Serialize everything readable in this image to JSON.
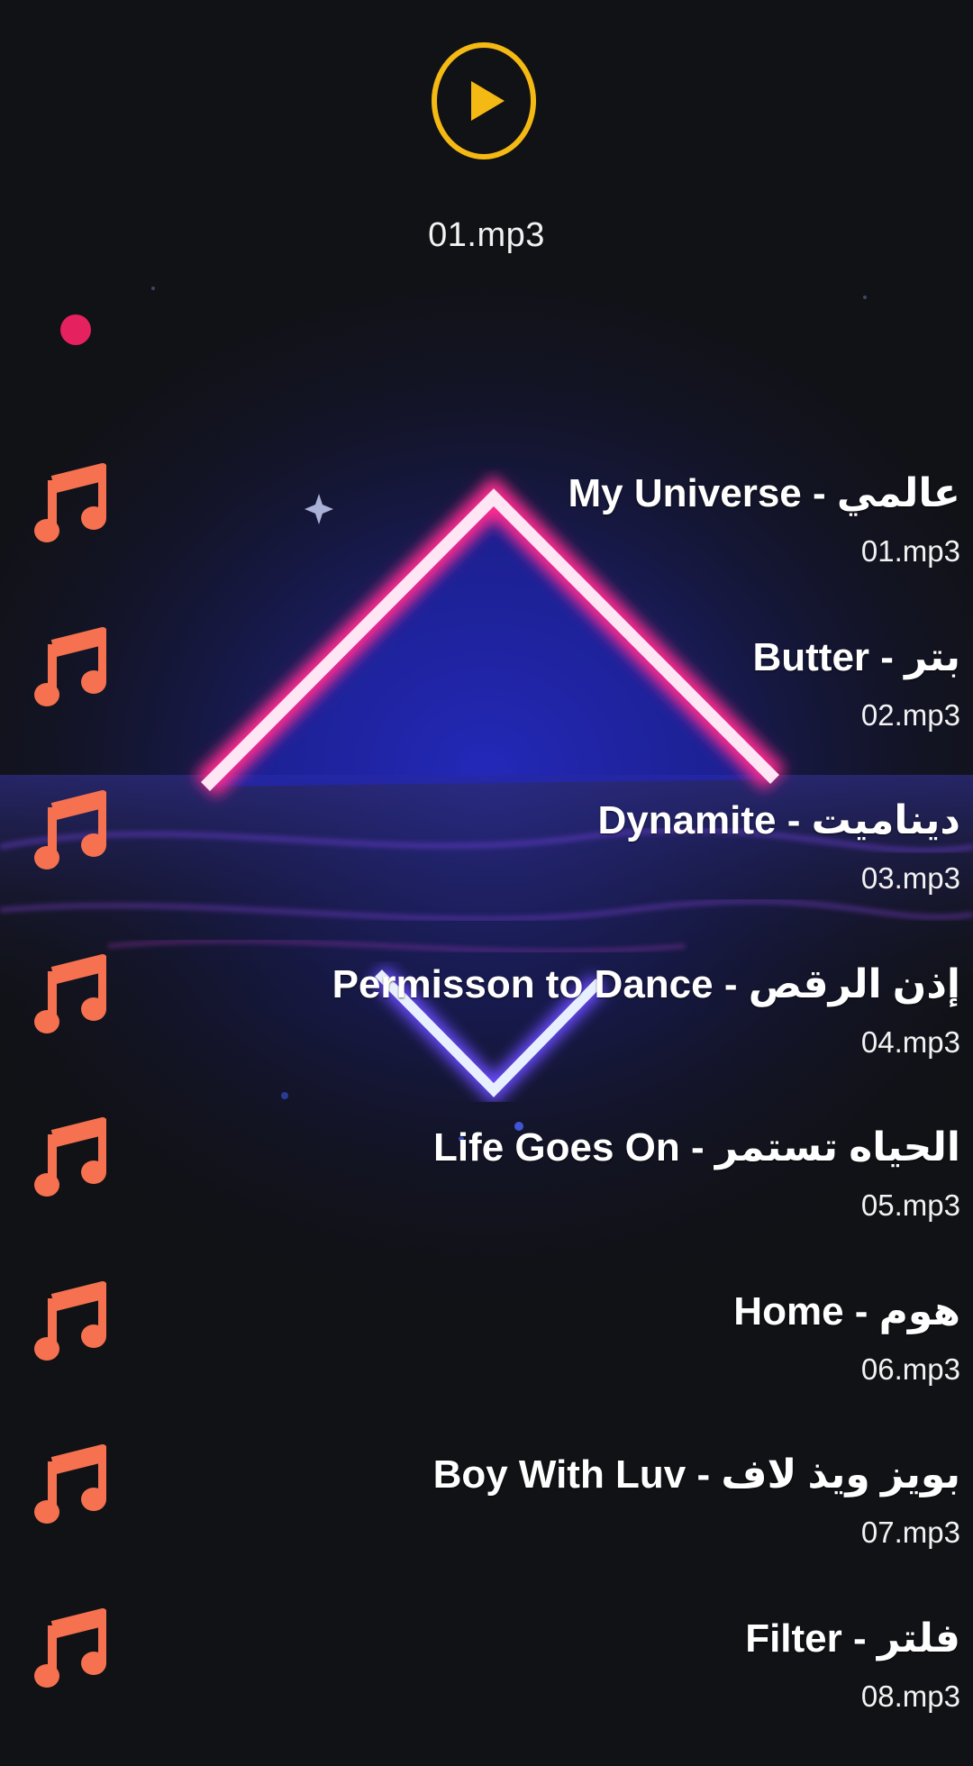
{
  "player": {
    "now_playing": "01.mp3",
    "play_icon": "play-circle-icon",
    "accent_color": "#f5b914",
    "record_dot_color": "#e5215f"
  },
  "playlist": {
    "icon": "music-note-icon",
    "icon_color": "#f5714f",
    "tracks": [
      {
        "title": "My Universe - عالمي",
        "file": "01.mp3"
      },
      {
        "title": "Butter - بتر",
        "file": "02.mp3"
      },
      {
        "title": "Dynamite - ديناميت",
        "file": "03.mp3"
      },
      {
        "title": "Permisson to Dance - إذن الرقص",
        "file": "04.mp3"
      },
      {
        "title": "Life Goes On - الحياه تستمر",
        "file": "05.mp3"
      },
      {
        "title": "Home - هوم",
        "file": "06.mp3"
      },
      {
        "title": "Boy With Luv - بويز ويذ لاف",
        "file": "07.mp3"
      },
      {
        "title": "Filter - فلتر",
        "file": "08.mp3"
      }
    ]
  }
}
